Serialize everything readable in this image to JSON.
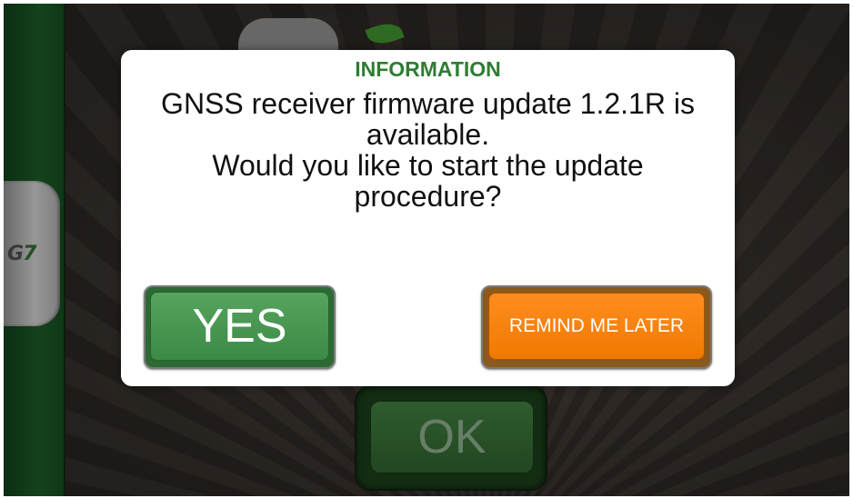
{
  "dialog": {
    "title": "INFORMATION",
    "message_lines": [
      "GNSS receiver firmware update 1.2.1R is",
      "available.",
      "Would you like to start the update",
      "procedure?"
    ],
    "yes_label": "YES",
    "later_label": "REMIND ME LATER"
  },
  "background": {
    "ok_label": "OK",
    "side_logo_g": "G",
    "side_logo_7": "7"
  },
  "colors": {
    "title_green": "#2e7d32",
    "yes_green": "#3b8a45",
    "later_orange": "#f07a00",
    "side_bar_green": "#1b5a25"
  },
  "icons": {
    "side_logo": "g7-logo-icon",
    "background_logo": "g7-leaf-logo-icon"
  }
}
